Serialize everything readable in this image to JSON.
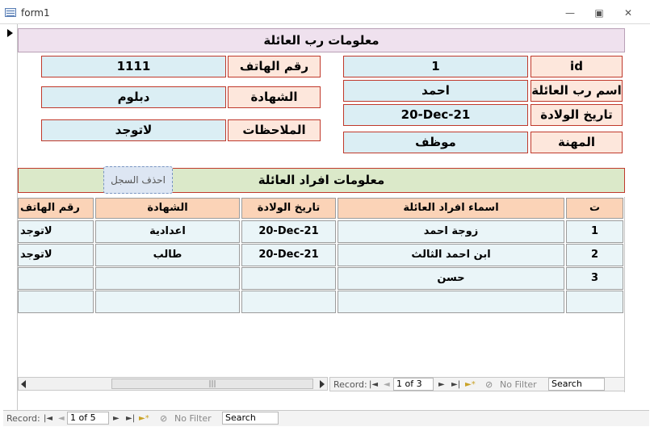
{
  "window": {
    "title": "form1"
  },
  "form_header": {
    "title": "معلومات رب العائلة"
  },
  "fields": {
    "id": {
      "label": "id",
      "value": "1"
    },
    "head_name": {
      "label": "اسم رب العائلة",
      "value": "احمد"
    },
    "birth_date": {
      "label": "تاريخ الولادة",
      "value": "20-Dec-21"
    },
    "job": {
      "label": "المهنة",
      "value": "موظف"
    },
    "phone": {
      "label": "رقم الهاتف",
      "value": "1111"
    },
    "certificate": {
      "label": "الشهادة",
      "value": "دبلوم"
    },
    "notes": {
      "label": "الملاحظات",
      "value": "لاتوجد"
    }
  },
  "subform": {
    "title": "معلومات افراد العائلة",
    "delete_button": "احذف السجل",
    "columns": [
      "ت",
      "اسماء افراد العائلة",
      "تاريخ الولادة",
      "الشهادة",
      "رقم الهاتف"
    ],
    "rows": [
      {
        "n": "1",
        "name": "زوجة احمد",
        "birth": "20-Dec-21",
        "cert": "اعدادية",
        "phone": "لاتوجد"
      },
      {
        "n": "2",
        "name": "ابن احمد الثالث",
        "birth": "20-Dec-21",
        "cert": "طالب",
        "phone": "لاتوجد"
      },
      {
        "n": "3",
        "name": "حسن",
        "birth": "",
        "cert": "",
        "phone": ""
      },
      {
        "n": "",
        "name": "",
        "birth": "",
        "cert": "",
        "phone": ""
      }
    ],
    "nav": {
      "record_label": "Record:",
      "position": "1 of 3",
      "filter": "No Filter",
      "search": "Search"
    }
  },
  "main_nav": {
    "record_label": "Record:",
    "position": "1 of 5",
    "filter": "No Filter",
    "search": "Search"
  },
  "colors": {
    "label_bg": "#fde7dc",
    "field_bg": "#dbeef4",
    "header_bg": "#efe1ee",
    "sub_header_bg": "#dbe9c9",
    "col_header_bg": "#fbd3b7"
  }
}
